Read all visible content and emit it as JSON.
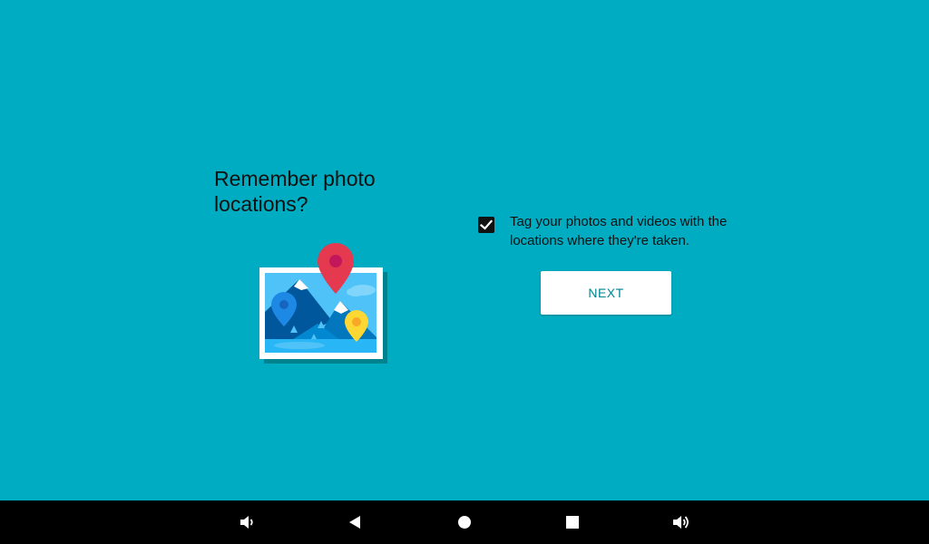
{
  "setup": {
    "title": "Remember photo locations?",
    "option_text": "Tag your photos and videos with the locations where they're taken.",
    "option_checked": true,
    "next_label": "NEXT"
  },
  "illustration": {
    "icon": "photo-location-pins-illustration"
  },
  "navbar": {
    "icons": [
      "volume-down-icon",
      "back-icon",
      "home-icon",
      "recents-icon",
      "volume-up-icon"
    ]
  },
  "colors": {
    "background": "#00ACC1",
    "button_text": "#00838F",
    "navbar": "#000000"
  }
}
